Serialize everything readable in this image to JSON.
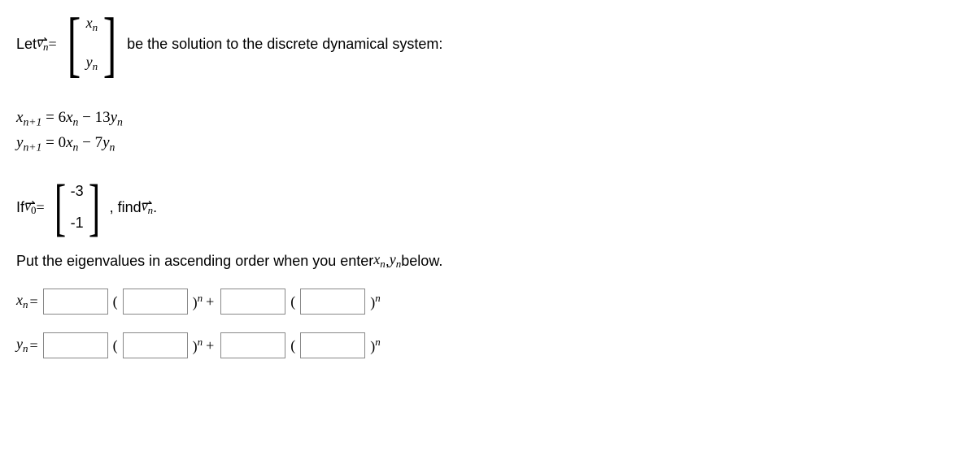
{
  "line1": {
    "let": "Let ",
    "v": "v",
    "sub": "n",
    "eq": " =",
    "matrix_top_x": "x",
    "matrix_top_sub": "n",
    "matrix_bot_y": "y",
    "matrix_bot_sub": "n",
    "after": " be the solution to the discrete dynamical system:"
  },
  "system": {
    "eq1": {
      "lhs_x": "x",
      "lhs_sub": "n+1",
      "eq": " = ",
      "a": "6",
      "x": "x",
      "xs": "n",
      "op": " − ",
      "b": "13",
      "y": "y",
      "ys": "n"
    },
    "eq2": {
      "lhs_y": "y",
      "lhs_sub": "n+1",
      "eq": " = ",
      "a": "0",
      "x": "x",
      "xs": "n",
      "op": " − ",
      "b": "7",
      "y": "y",
      "ys": "n"
    }
  },
  "line3": {
    "if": "If ",
    "v": "v",
    "sub": "0",
    "eq": " =",
    "top": "-3",
    "bot": "-1",
    "findpre": ", find ",
    "v2": "v",
    "sub2": "n",
    "dot": "."
  },
  "instruction": {
    "pre": "Put the eigenvalues in ascending order when you enter ",
    "x": "x",
    "xs": "n",
    "comma": ", ",
    "y": "y",
    "ys": "n",
    "post": " below."
  },
  "answers": {
    "xn_label_x": "x",
    "xn_label_sub": "n",
    "eq": " = ",
    "yn_label_y": "y",
    "yn_label_sub": "n",
    "lp": " (",
    "rp_np": ")",
    "np": "n",
    "plus": "+",
    "rp_n": ")",
    "n2": "n"
  }
}
